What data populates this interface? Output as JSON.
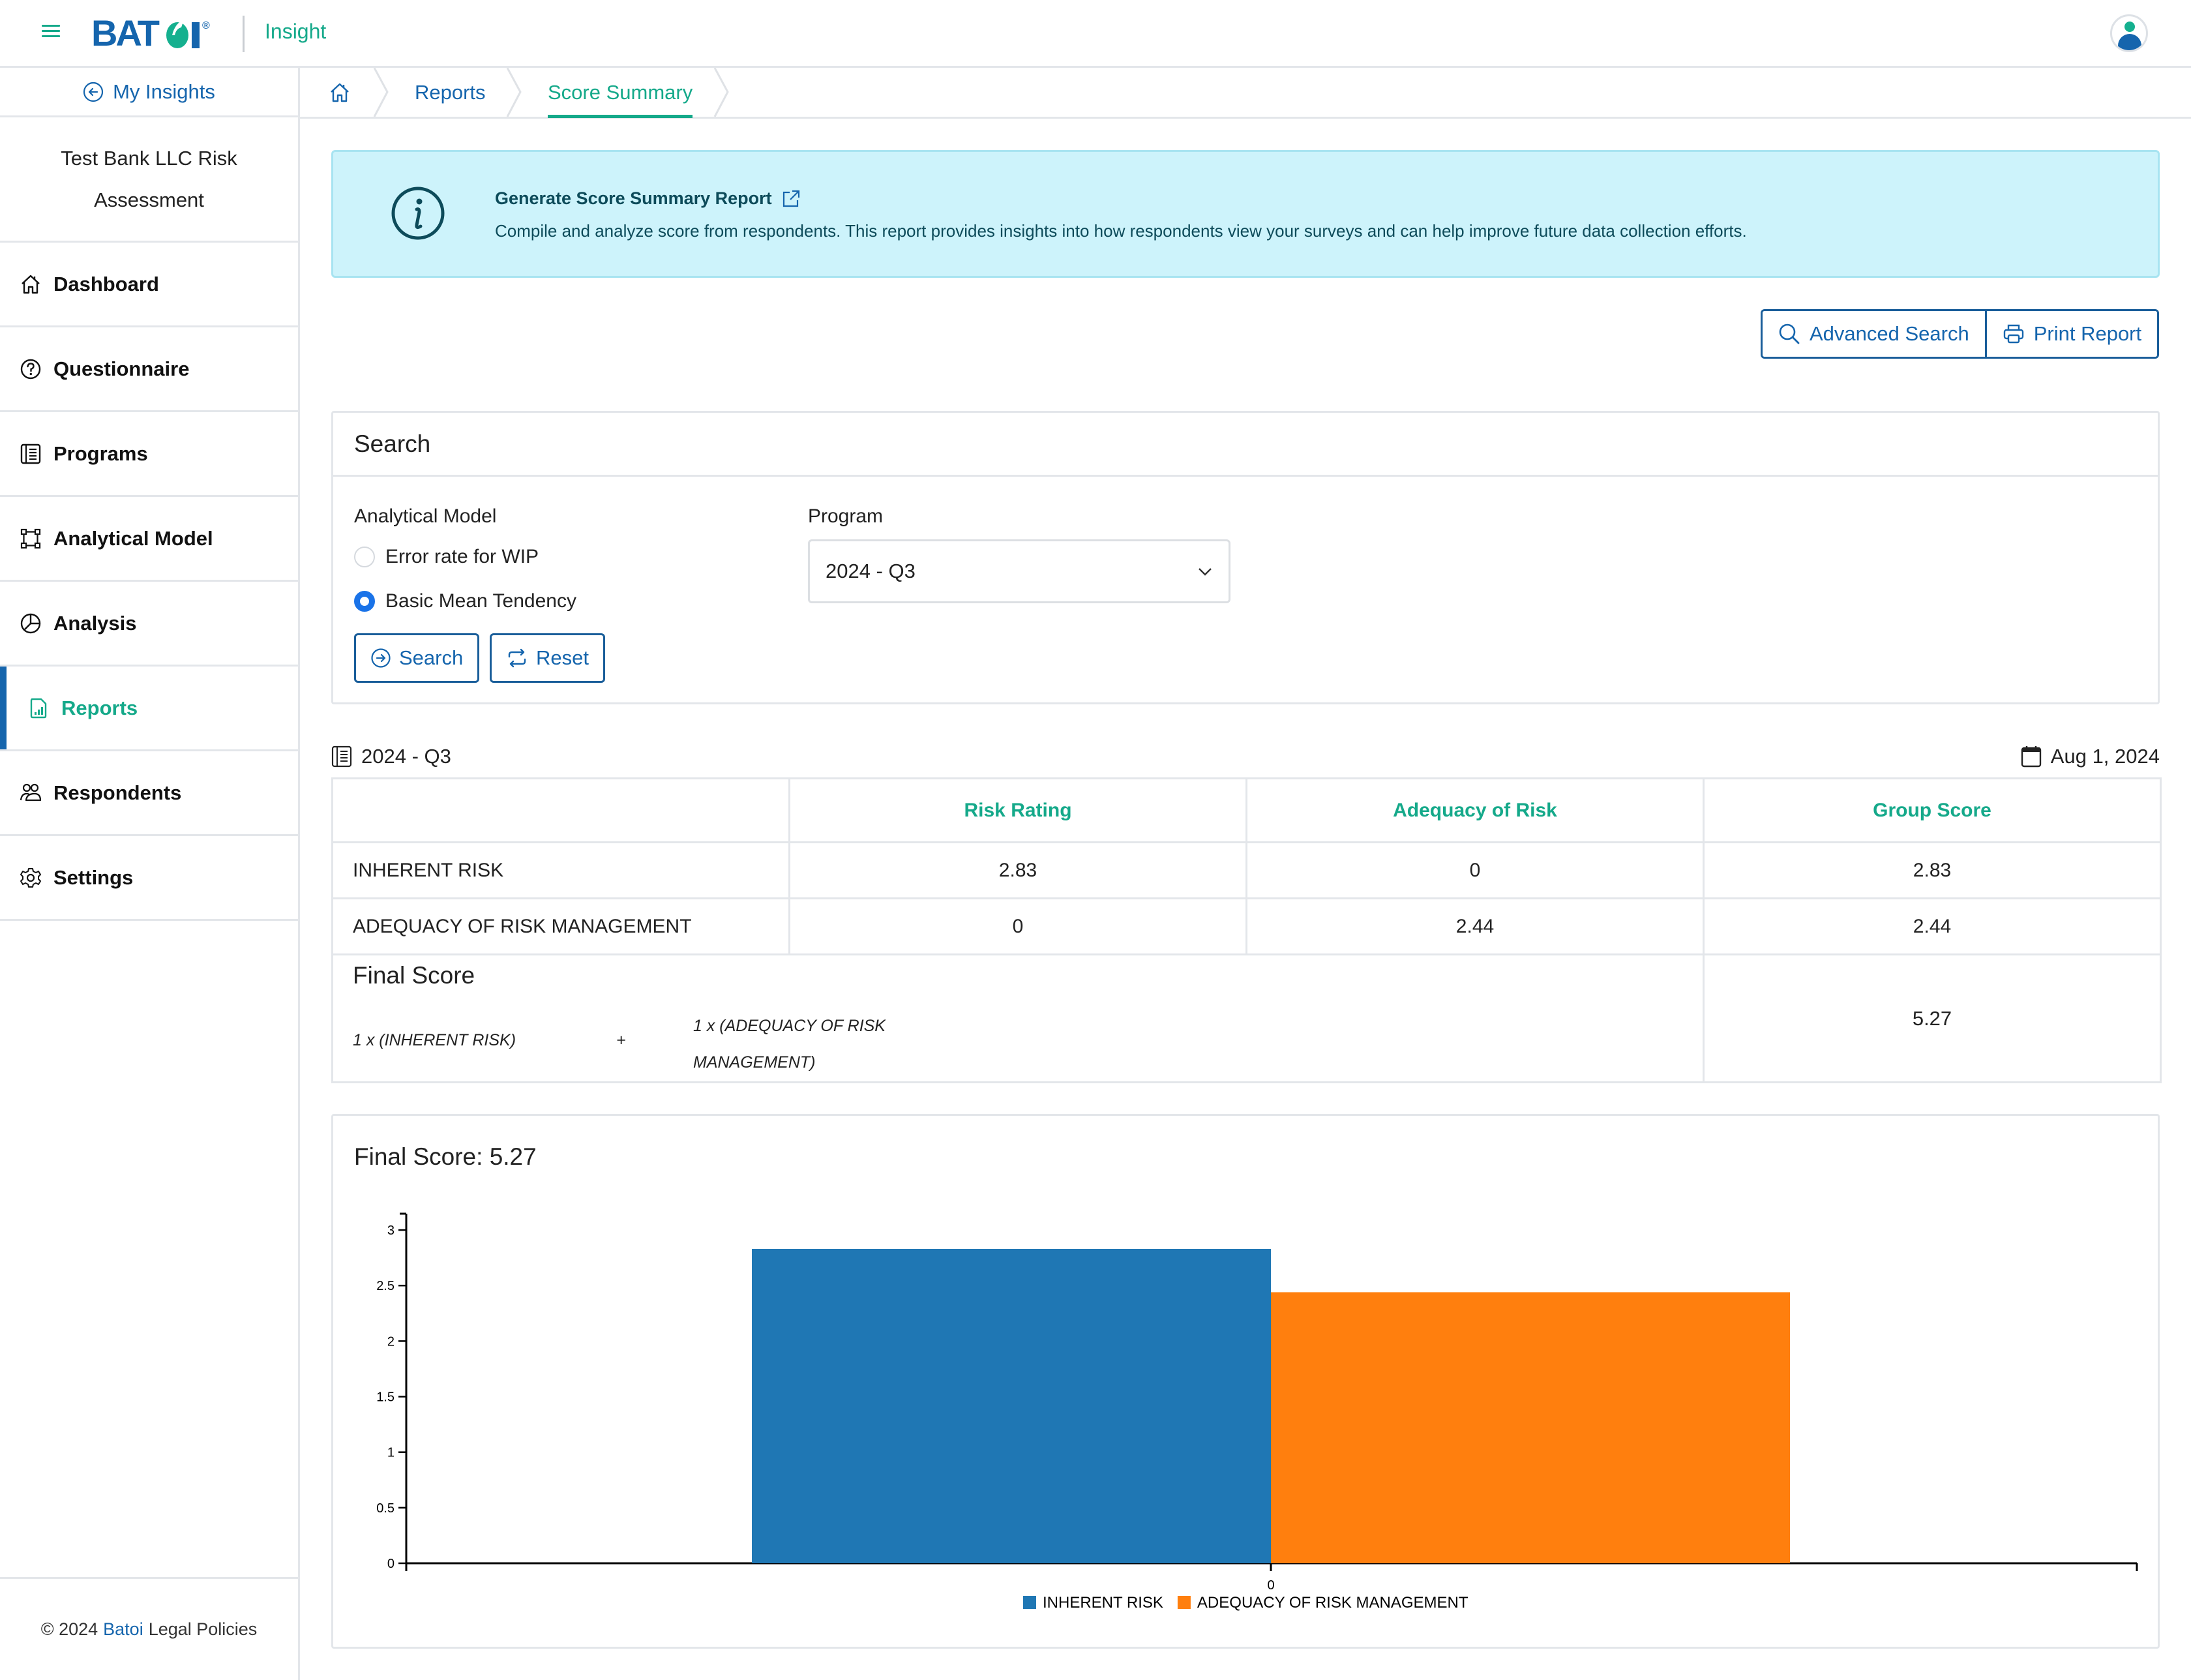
{
  "header": {
    "brand": "BATOI",
    "app_name": "Insight",
    "menu_icon": "hamburger-icon",
    "avatar_icon": "user-avatar-icon"
  },
  "sidebar": {
    "back_label": "My Insights",
    "project_title": "Test Bank LLC Risk Assessment",
    "items": [
      {
        "label": "Dashboard",
        "icon": "home-icon",
        "active": false
      },
      {
        "label": "Questionnaire",
        "icon": "question-circle-icon",
        "active": false
      },
      {
        "label": "Programs",
        "icon": "list-book-icon",
        "active": false
      },
      {
        "label": "Analytical Model",
        "icon": "bounding-box-icon",
        "active": false
      },
      {
        "label": "Analysis",
        "icon": "pie-chart-icon",
        "active": false
      },
      {
        "label": "Reports",
        "icon": "report-chart-icon",
        "active": true
      },
      {
        "label": "Respondents",
        "icon": "people-icon",
        "active": false
      },
      {
        "label": "Settings",
        "icon": "gear-icon",
        "active": false
      }
    ],
    "footer": {
      "copyright": "© 2024",
      "brand_link": "Batoi",
      "legal_link": "Legal Policies"
    }
  },
  "breadcrumb": {
    "items": [
      "Reports",
      "Score Summary"
    ],
    "current": "Score Summary"
  },
  "banner": {
    "title": "Generate Score Summary Report",
    "text": "Compile and analyze score from respondents. This report provides insights into how respondents view your surveys and can help improve future data collection efforts."
  },
  "actions": {
    "advanced_search": "Advanced Search",
    "print_report": "Print Report"
  },
  "search": {
    "title": "Search",
    "analytical_model_label": "Analytical Model",
    "models": [
      {
        "label": "Error rate for WIP",
        "checked": false
      },
      {
        "label": "Basic Mean Tendency",
        "checked": true
      }
    ],
    "program_label": "Program",
    "program_value": "2024 - Q3",
    "search_button": "Search",
    "reset_button": "Reset"
  },
  "report": {
    "program": "2024 - Q3",
    "date": "Aug 1, 2024",
    "columns": [
      "",
      "Risk Rating",
      "Adequacy of Risk",
      "Group Score"
    ],
    "rows": [
      {
        "name": "INHERENT RISK",
        "risk_rating": "2.83",
        "adequacy": "0",
        "group_score": "2.83"
      },
      {
        "name": "ADEQUACY OF RISK MANAGEMENT",
        "risk_rating": "0",
        "adequacy": "2.44",
        "group_score": "2.44"
      }
    ],
    "final_score_label": "Final Score",
    "formula_term_1": "1 x (INHERENT RISK)",
    "formula_operator": "+",
    "formula_term_2": "1 x (ADEQUACY OF RISK MANAGEMENT)",
    "final_score": "5.27"
  },
  "chart_data": {
    "type": "bar",
    "title": "Final Score: 5.27",
    "categories": [
      "0"
    ],
    "series": [
      {
        "name": "INHERENT RISK",
        "values": [
          2.83
        ],
        "color": "#1f77b4"
      },
      {
        "name": "ADEQUACY OF RISK MANAGEMENT",
        "values": [
          2.44
        ],
        "color": "#ff7f0e"
      }
    ],
    "xlabel": "",
    "ylabel": "",
    "ylim": [
      0,
      3.1
    ],
    "yticks": [
      0,
      0.5,
      1,
      1.5,
      2,
      2.5,
      3
    ],
    "ytick_labels": [
      "0",
      "0.5",
      "1",
      "1.5",
      "2",
      "2.5",
      "3"
    ],
    "grid": false,
    "legend": "bottom-center"
  }
}
